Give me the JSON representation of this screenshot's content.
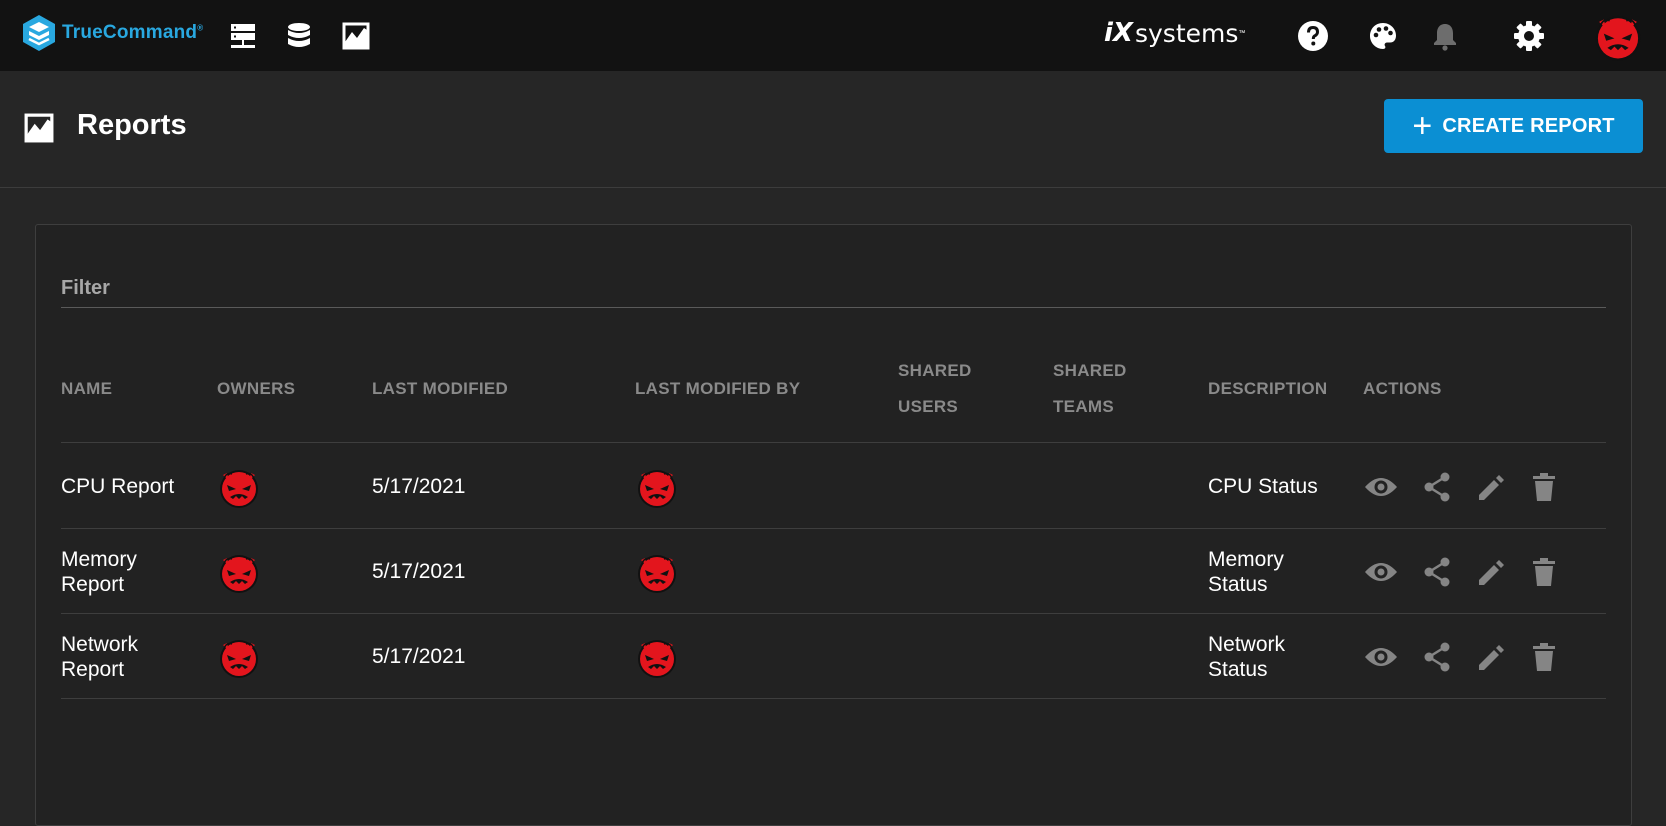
{
  "app": {
    "brand": "TrueCommand",
    "vendor_prefix": "iX",
    "vendor_suffix": "systems",
    "vendor_tm": "™",
    "brand_tm": "®"
  },
  "nav": {
    "icons": [
      "servers-icon",
      "datasets-icon",
      "reports-icon"
    ]
  },
  "header": {
    "title": "Reports",
    "create_label": "CREATE REPORT"
  },
  "filter": {
    "label": "Filter"
  },
  "table": {
    "columns": {
      "name": "NAME",
      "owners": "OWNERS",
      "last_modified": "LAST MODIFIED",
      "last_modified_by": "LAST MODIFIED BY",
      "shared_users_1": "SHARED",
      "shared_users_2": "USERS",
      "shared_teams_1": "SHARED",
      "shared_teams_2": "TEAMS",
      "description": "DESCRIPTION",
      "actions": "ACTIONS"
    },
    "rows": [
      {
        "name_1": "CPU Report",
        "name_2": "",
        "last_modified": "5/17/2021",
        "desc_1": "CPU Status",
        "desc_2": ""
      },
      {
        "name_1": "Memory",
        "name_2": "Report",
        "last_modified": "5/17/2021",
        "desc_1": "Memory",
        "desc_2": "Status"
      },
      {
        "name_1": "Network",
        "name_2": "Report",
        "last_modified": "5/17/2021",
        "desc_1": "Network",
        "desc_2": "Status"
      }
    ]
  },
  "colors": {
    "accent": "#0b8fd3",
    "brand": "#29a8e0",
    "avatar": "#e3151d"
  }
}
